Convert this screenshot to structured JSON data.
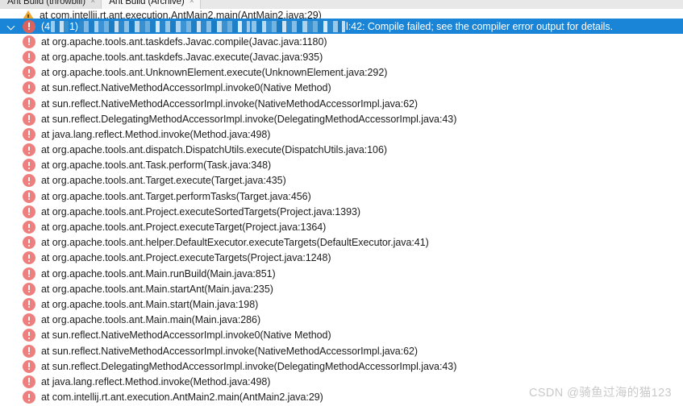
{
  "window": {
    "title": "Ant Build"
  },
  "tabs": [
    {
      "label": "Ant Build (throwbill)",
      "active": false,
      "close_glyph": "×"
    },
    {
      "label": "Ant Build (Archive)",
      "active": true,
      "close_glyph": "×"
    }
  ],
  "colors": {
    "selection": "#1a85d6",
    "error_icon": "#ee7f7f",
    "warning_icon": "#f0a732",
    "tab_active_bg": "#f7f7f7",
    "tab_inactive_bg": "#e2e2e2",
    "watermark": "#c9c9c9"
  },
  "selected_row": {
    "icon": "error-icon",
    "twisty": "chevron-down-icon",
    "prefix": "(4",
    "middle": "1)",
    "suffix": "l:42: Compile failed; see the compiler error output for details.",
    "redacted": true
  },
  "rows": [
    {
      "icon": "warning-icon",
      "text": "at com.intellij.rt.ant.execution.AntMain2.main(AntMain2.java:29)",
      "clipped": true
    },
    {
      "icon": "error-icon",
      "text": "at org.apache.tools.ant.taskdefs.Javac.compile(Javac.java:1180)"
    },
    {
      "icon": "error-icon",
      "text": "at org.apache.tools.ant.taskdefs.Javac.execute(Javac.java:935)"
    },
    {
      "icon": "error-icon",
      "text": "at org.apache.tools.ant.UnknownElement.execute(UnknownElement.java:292)"
    },
    {
      "icon": "error-icon",
      "text": "at sun.reflect.NativeMethodAccessorImpl.invoke0(Native Method)"
    },
    {
      "icon": "error-icon",
      "text": "at sun.reflect.NativeMethodAccessorImpl.invoke(NativeMethodAccessorImpl.java:62)"
    },
    {
      "icon": "error-icon",
      "text": "at sun.reflect.DelegatingMethodAccessorImpl.invoke(DelegatingMethodAccessorImpl.java:43)"
    },
    {
      "icon": "error-icon",
      "text": "at java.lang.reflect.Method.invoke(Method.java:498)"
    },
    {
      "icon": "error-icon",
      "text": "at org.apache.tools.ant.dispatch.DispatchUtils.execute(DispatchUtils.java:106)"
    },
    {
      "icon": "error-icon",
      "text": "at org.apache.tools.ant.Task.perform(Task.java:348)"
    },
    {
      "icon": "error-icon",
      "text": "at org.apache.tools.ant.Target.execute(Target.java:435)"
    },
    {
      "icon": "error-icon",
      "text": "at org.apache.tools.ant.Target.performTasks(Target.java:456)"
    },
    {
      "icon": "error-icon",
      "text": "at org.apache.tools.ant.Project.executeSortedTargets(Project.java:1393)"
    },
    {
      "icon": "error-icon",
      "text": "at org.apache.tools.ant.Project.executeTarget(Project.java:1364)"
    },
    {
      "icon": "error-icon",
      "text": "at org.apache.tools.ant.helper.DefaultExecutor.executeTargets(DefaultExecutor.java:41)"
    },
    {
      "icon": "error-icon",
      "text": "at org.apache.tools.ant.Project.executeTargets(Project.java:1248)"
    },
    {
      "icon": "error-icon",
      "text": "at org.apache.tools.ant.Main.runBuild(Main.java:851)"
    },
    {
      "icon": "error-icon",
      "text": "at org.apache.tools.ant.Main.startAnt(Main.java:235)"
    },
    {
      "icon": "error-icon",
      "text": "at org.apache.tools.ant.Main.start(Main.java:198)"
    },
    {
      "icon": "error-icon",
      "text": "at org.apache.tools.ant.Main.main(Main.java:286)"
    },
    {
      "icon": "error-icon",
      "text": "at sun.reflect.NativeMethodAccessorImpl.invoke0(Native Method)"
    },
    {
      "icon": "error-icon",
      "text": "at sun.reflect.NativeMethodAccessorImpl.invoke(NativeMethodAccessorImpl.java:62)"
    },
    {
      "icon": "error-icon",
      "text": "at sun.reflect.DelegatingMethodAccessorImpl.invoke(DelegatingMethodAccessorImpl.java:43)"
    },
    {
      "icon": "error-icon",
      "text": "at java.lang.reflect.Method.invoke(Method.java:498)"
    },
    {
      "icon": "error-icon",
      "text": "at com.intellij.rt.ant.execution.AntMain2.main(AntMain2.java:29)"
    }
  ],
  "watermark": "CSDN @骑鱼过海的猫123"
}
